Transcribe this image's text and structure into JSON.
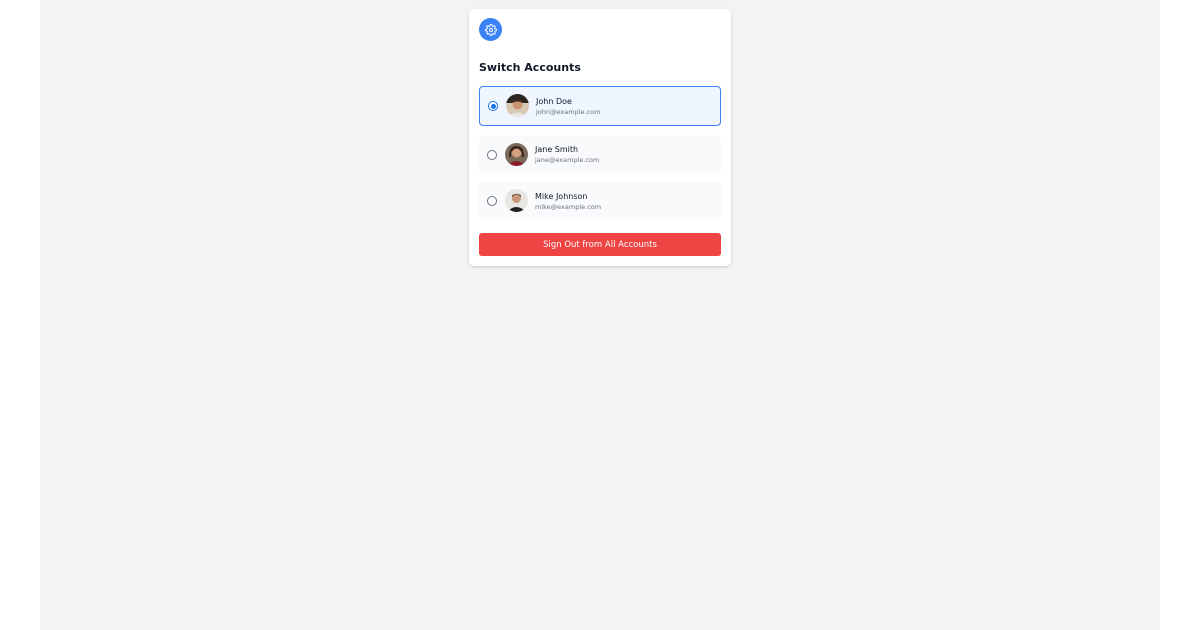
{
  "header": {
    "settings_icon": "gear-icon",
    "title": "Switch Accounts"
  },
  "accounts": [
    {
      "name": "John Doe",
      "email": "john@example.com",
      "selected": true,
      "avatar": "avatar-photo"
    },
    {
      "name": "Jane Smith",
      "email": "jane@example.com",
      "selected": false,
      "avatar": "avatar-photo"
    },
    {
      "name": "Mike Johnson",
      "email": "mike@example.com",
      "selected": false,
      "avatar": "avatar-photo"
    }
  ],
  "footer": {
    "signout_label": "Sign Out from All Accounts"
  },
  "colors": {
    "accent": "#3b82f6",
    "danger": "#ef4444",
    "selected_bg": "#eff6ff",
    "page_bg": "#f2f3f5"
  }
}
